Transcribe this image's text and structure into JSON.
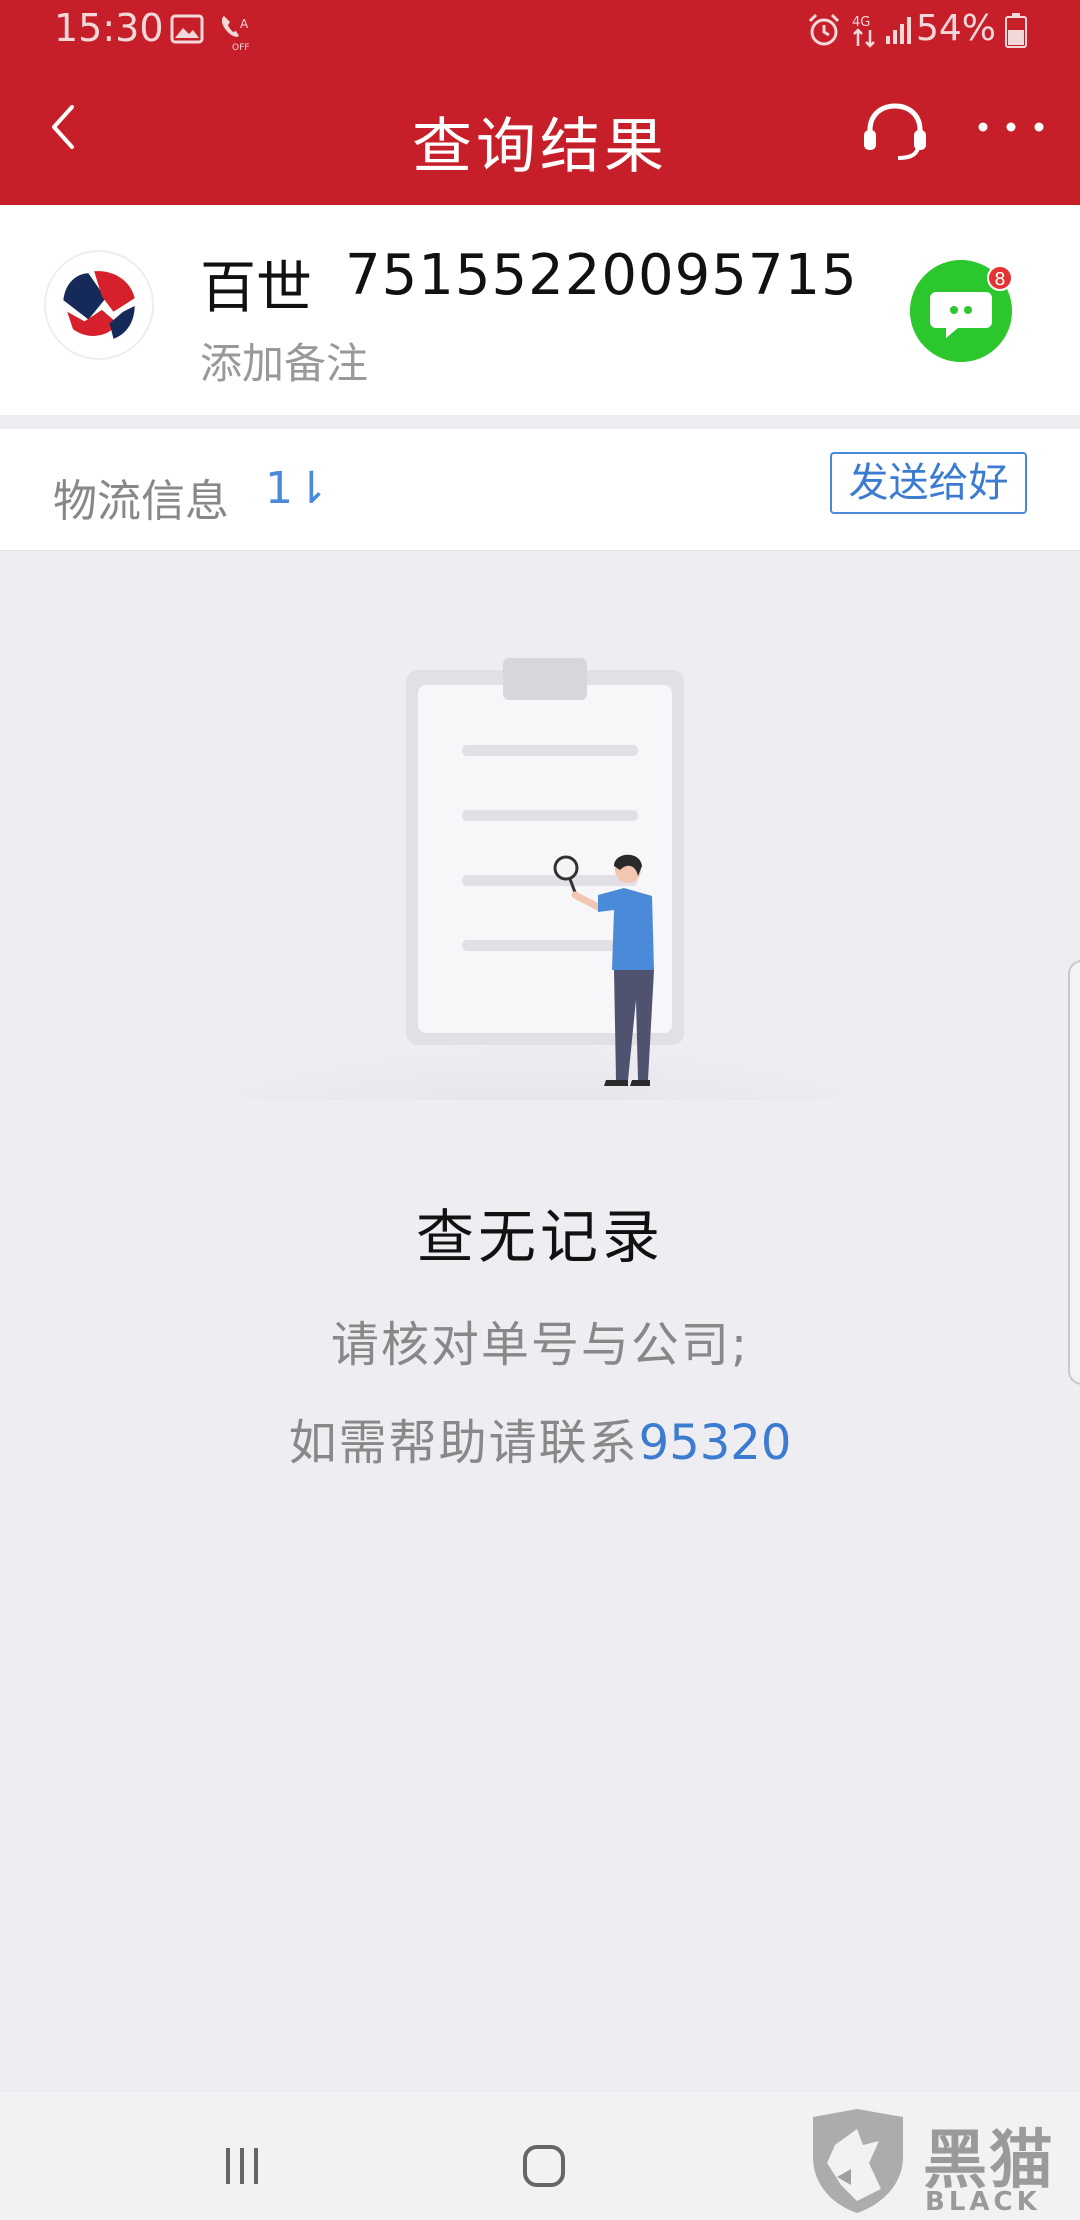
{
  "status_bar": {
    "time": "15:30",
    "battery": "54%",
    "icons": [
      "image-icon",
      "wifi-call-off-icon",
      "alarm-icon",
      "4g-data-icon",
      "signal-icon",
      "battery-icon"
    ]
  },
  "app_bar": {
    "title": "查询结果",
    "background_color": "#c71f2a",
    "icons": [
      "back-arrow-icon",
      "headset-icon",
      "more-dots-icon"
    ]
  },
  "parcel": {
    "courier": "百世",
    "tracking_number": "75155220095715",
    "note_placeholder": "添加备注",
    "chat_badge_count": "8"
  },
  "logistics": {
    "label": "物流信息",
    "sort_glyph": "1⇂",
    "send_button": "发送给好"
  },
  "empty_state": {
    "title": "查无记录",
    "hint_line1": "请核对单号与公司;",
    "hint_line2_prefix": "如需帮助请联系",
    "phone": "95320"
  },
  "watermark": {
    "cn": "黑猫",
    "en": "BLACK CAT"
  },
  "colors": {
    "accent": "#c71f2a",
    "link": "#3b7bd0",
    "chat_green": "#2cc72c"
  }
}
